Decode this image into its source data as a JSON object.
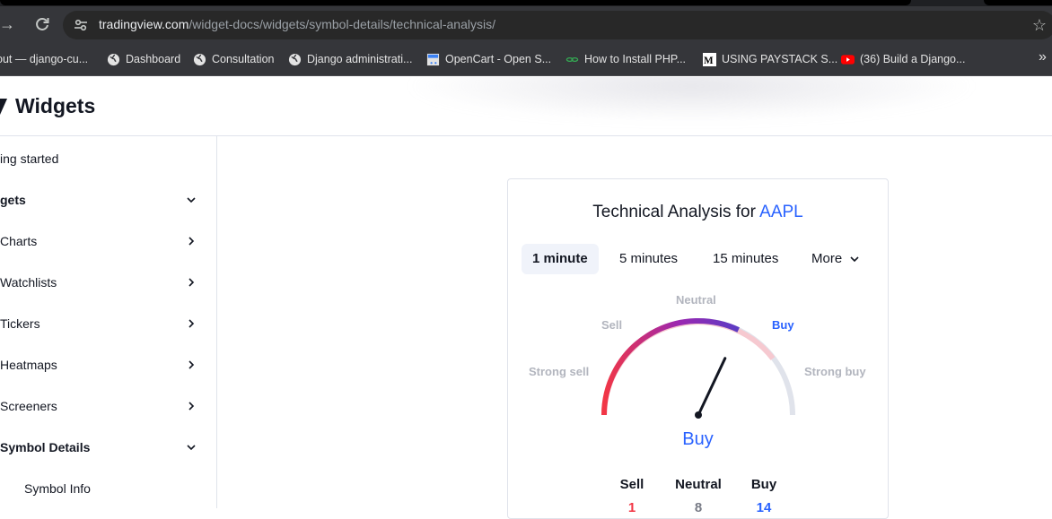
{
  "browser": {
    "url_domain": "tradingview.com",
    "url_path": "/widget-docs/widgets/symbol-details/technical-analysis/",
    "bookmarks": [
      {
        "label": "out — django-cu...",
        "icon": "globe-icon"
      },
      {
        "label": "Dashboard",
        "icon": "globe-icon"
      },
      {
        "label": "Consultation",
        "icon": "globe-icon"
      },
      {
        "label": "Django administrati...",
        "icon": "globe-icon"
      },
      {
        "label": "OpenCart - Open S...",
        "icon": "opencart-icon"
      },
      {
        "label": "How to Install PHP...",
        "icon": "link-icon"
      },
      {
        "label": "USING PAYSTACK S...",
        "icon": "medium-icon"
      },
      {
        "label": "(36) Build a Django...",
        "icon": "youtube-icon"
      }
    ],
    "more_bookmarks": "»"
  },
  "header": {
    "title": "Widgets"
  },
  "sidebar": {
    "items": [
      {
        "label": "ing started",
        "chevron": "none"
      },
      {
        "label": "gets",
        "chevron": "down"
      },
      {
        "label": "Charts",
        "chevron": "right"
      },
      {
        "label": "Watchlists",
        "chevron": "right"
      },
      {
        "label": "Tickers",
        "chevron": "right"
      },
      {
        "label": "Heatmaps",
        "chevron": "right"
      },
      {
        "label": "Screeners",
        "chevron": "right"
      },
      {
        "label": "Symbol Details",
        "chevron": "down"
      },
      {
        "label": "Symbol Info",
        "chevron": "none"
      }
    ]
  },
  "widget": {
    "title_prefix": "Technical Analysis for",
    "symbol": "AAPL",
    "intervals": [
      {
        "label": "1 minute",
        "active": true
      },
      {
        "label": "5 minutes",
        "active": false
      },
      {
        "label": "15 minutes",
        "active": false
      },
      {
        "label": "More",
        "active": false
      }
    ],
    "gauge": {
      "labels": {
        "strong_sell": "Strong sell",
        "sell": "Sell",
        "neutral": "Neutral",
        "buy": "Buy",
        "strong_buy": "Strong buy"
      },
      "needle_value": 0.64,
      "colors": {
        "sell": "#f23645",
        "neutral": "#9c27b0",
        "buy": "#2962ff",
        "track": "#e0e3eb"
      }
    },
    "verdict": "Buy",
    "summary": [
      {
        "label": "Sell",
        "value": "1",
        "color": "#f23645"
      },
      {
        "label": "Neutral",
        "value": "8",
        "color": "#787b86"
      },
      {
        "label": "Buy",
        "value": "14",
        "color": "#2962ff"
      }
    ]
  }
}
